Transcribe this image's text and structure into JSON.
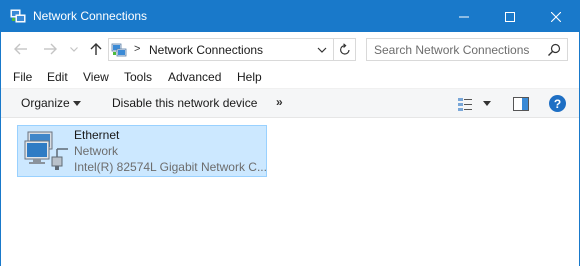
{
  "window": {
    "title": "Network Connections",
    "title_icon": "network-connections-icon",
    "accent_color": "#1979ca"
  },
  "navigation": {
    "address_separator": ">",
    "address_path": "Network Connections",
    "search_placeholder": "Search Network Connections"
  },
  "menu": {
    "items": [
      "File",
      "Edit",
      "View",
      "Tools",
      "Advanced",
      "Help"
    ]
  },
  "command_bar": {
    "organize_label": "Organize",
    "disable_label": "Disable this network device",
    "more_label": "»",
    "help_label": "?"
  },
  "connections": [
    {
      "name": "Ethernet",
      "status": "Network",
      "device": "Intel(R) 82574L Gigabit Network C...",
      "icon": "ethernet-adapter-icon",
      "selected": true
    }
  ]
}
